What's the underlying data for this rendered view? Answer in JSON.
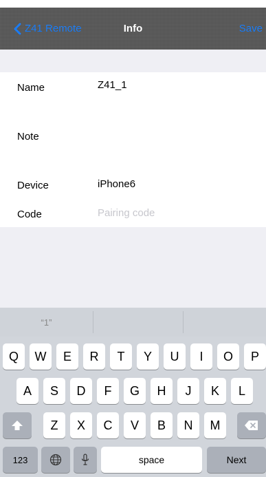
{
  "nav": {
    "back_label": "Z41 Remote",
    "title": "Info",
    "save_label": "Save"
  },
  "form": {
    "rows": [
      {
        "label": "Name",
        "value": "Z41_1"
      },
      {
        "label": "Note",
        "value": ""
      },
      {
        "label": "Device",
        "value": "iPhone6"
      },
      {
        "label": "Code",
        "value": "",
        "placeholder": "Pairing code"
      }
    ]
  },
  "keyboard": {
    "predictions": [
      "“1”",
      "",
      ""
    ],
    "row1": [
      "Q",
      "W",
      "E",
      "R",
      "T",
      "Y",
      "U",
      "I",
      "O",
      "P"
    ],
    "row2": [
      "A",
      "S",
      "D",
      "F",
      "G",
      "H",
      "J",
      "K",
      "L"
    ],
    "row3": [
      "Z",
      "X",
      "C",
      "V",
      "B",
      "N",
      "M"
    ],
    "numbers_label": "123",
    "space_label": "space",
    "return_label": "Next"
  },
  "colors": {
    "accent": "#1a7cf5",
    "nav_background": "#555555",
    "page_background": "#efeff4",
    "keyboard_background": "#d1d5db"
  },
  "icons": [
    "chevron-left-icon",
    "shift-icon",
    "delete-icon",
    "globe-icon",
    "microphone-icon"
  ]
}
